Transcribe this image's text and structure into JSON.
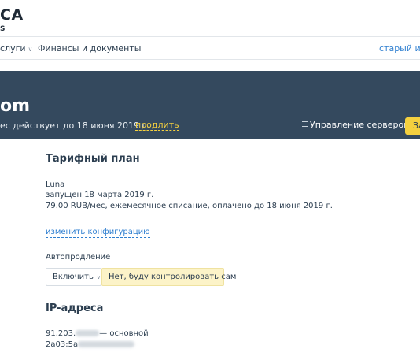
{
  "brand": {
    "line1": "CA",
    "line2": "S"
  },
  "nav": {
    "services": "слуги",
    "finance": "Финансы и документы",
    "old_interface": "старый инте"
  },
  "server": {
    "title": "om",
    "status": "ес  действует до 18 июня 2019 г.",
    "renew_link": "продлить",
    "manage_label": "Управление сервером",
    "action_label": "За"
  },
  "plan": {
    "heading": "Тарифный план",
    "name": "Luna",
    "started": "запущен 18 марта 2019 г.",
    "price": "79.00 RUB/мес, ежемесячное списание, оплачено до 18 июня 2019 г.",
    "change_link": "изменить конфигурацию"
  },
  "autorenew": {
    "label": "Автопродление",
    "select_value": "Включить",
    "option_manual": "Нет, буду контролировать сам"
  },
  "ip": {
    "heading": "IP-адреса",
    "ipv4_prefix": "91.203.",
    "ipv4_suffix": "— основной",
    "ipv6_prefix": "2a03:5a"
  }
}
